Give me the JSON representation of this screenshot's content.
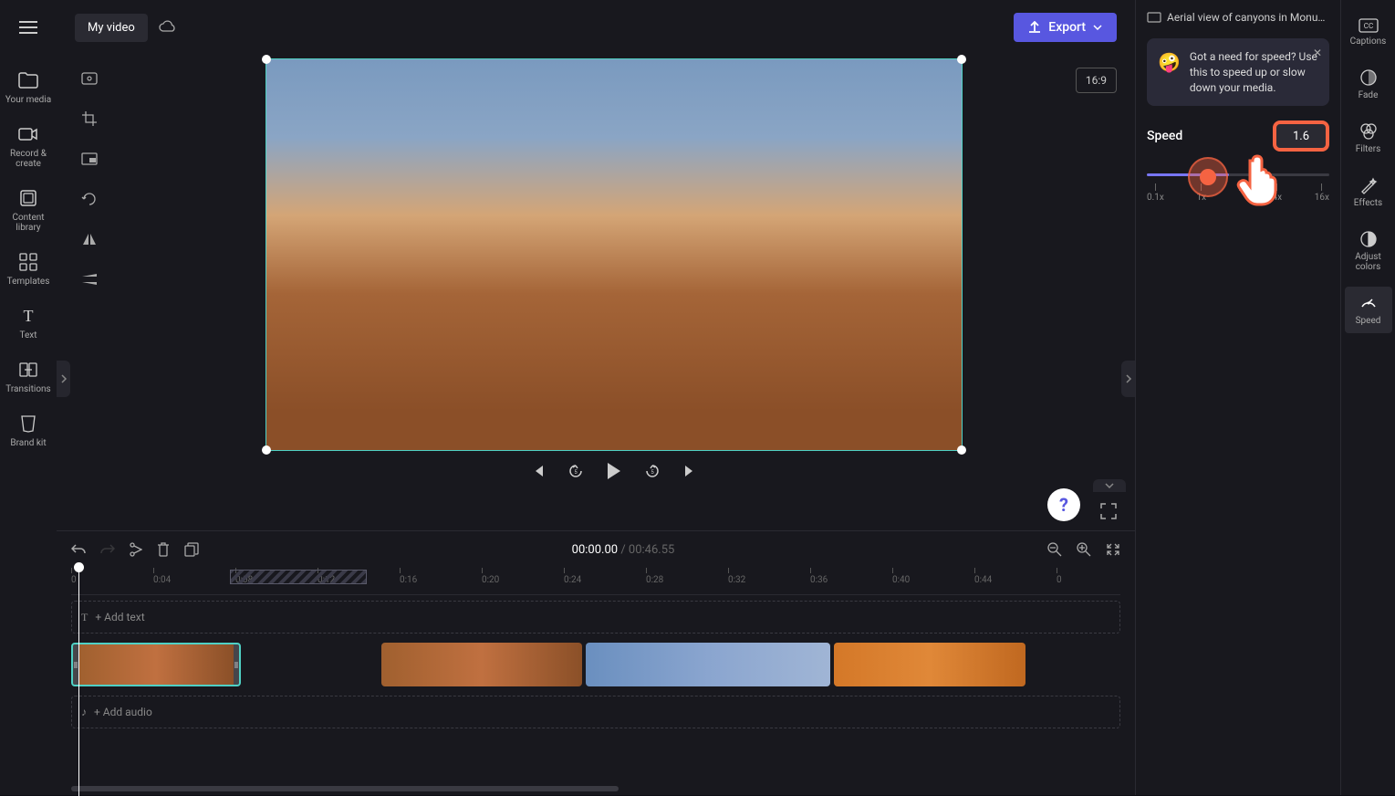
{
  "header": {
    "title": "My video",
    "export_label": "Export",
    "aspect_ratio": "16:9"
  },
  "left_sidebar": {
    "items": [
      {
        "label": "Your media",
        "icon": "folder"
      },
      {
        "label": "Record & create",
        "icon": "camera"
      },
      {
        "label": "Content library",
        "icon": "library"
      },
      {
        "label": "Templates",
        "icon": "templates"
      },
      {
        "label": "Text",
        "icon": "text"
      },
      {
        "label": "Transitions",
        "icon": "transitions"
      },
      {
        "label": "Brand kit",
        "icon": "brand"
      }
    ]
  },
  "right_sidebar": {
    "items": [
      {
        "label": "Captions",
        "icon": "cc"
      },
      {
        "label": "Fade",
        "icon": "fade"
      },
      {
        "label": "Filters",
        "icon": "filters"
      },
      {
        "label": "Effects",
        "icon": "effects"
      },
      {
        "label": "Adjust colors",
        "icon": "adjust"
      },
      {
        "label": "Speed",
        "icon": "speed",
        "active": true
      }
    ]
  },
  "asset_name": "Aerial view of canyons in Monu…",
  "tooltip": {
    "emoji": "🤪",
    "text": "Got a need for speed? Use this to speed up or slow down your media."
  },
  "speed": {
    "label": "Speed",
    "value": "1.6",
    "ticks": [
      "0.1x",
      "1x",
      "",
      "4x",
      "16x"
    ]
  },
  "timeline": {
    "current": "00:00.00",
    "duration": "00:46.55",
    "marks": [
      "0",
      "0:04",
      "0:08",
      "0:12",
      "0:16",
      "0:20",
      "0:24",
      "0:28",
      "0:32",
      "0:36",
      "0:40",
      "0:44",
      "0"
    ],
    "add_text": "+ Add text",
    "add_audio": "+ Add audio"
  }
}
